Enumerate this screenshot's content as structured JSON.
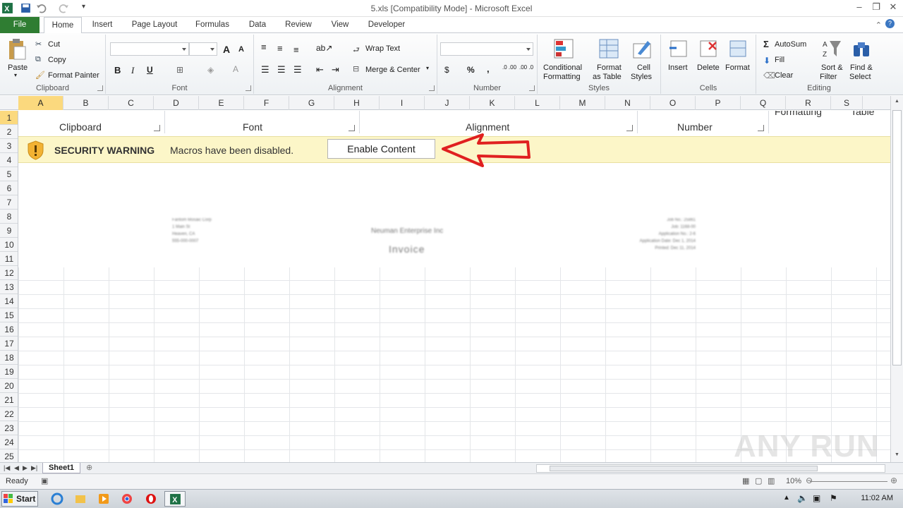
{
  "window": {
    "title": "5.xls  [Compatibility Mode]  -  Microsoft Excel"
  },
  "tabs": [
    "File",
    "Home",
    "Insert",
    "Page Layout",
    "Formulas",
    "Data",
    "Review",
    "View",
    "Developer"
  ],
  "ribbon": {
    "clipboard": {
      "paste": "Paste",
      "cut": "Cut",
      "copy": "Copy",
      "format_painter": "Format Painter",
      "label": "Clipboard"
    },
    "font": {
      "label": "Font",
      "bold": "B",
      "italic": "I",
      "underline": "U",
      "grow": "A",
      "shrink": "A"
    },
    "alignment": {
      "label": "Alignment",
      "wrap": "Wrap Text",
      "merge": "Merge & Center"
    },
    "number": {
      "label": "Number",
      "currency": "$",
      "percent": "%",
      "comma": ",",
      "inc": ".0 .00",
      "dec": ".00 .0"
    },
    "styles": {
      "label": "Styles",
      "conditional_1": "Conditional",
      "conditional_2": "Formatting",
      "format_table_1": "Format",
      "format_table_2": "as Table",
      "cell_styles_1": "Cell",
      "cell_styles_2": "Styles"
    },
    "cells": {
      "label": "Cells",
      "insert": "Insert",
      "delete": "Delete",
      "format": "Format"
    },
    "editing": {
      "label": "Editing",
      "autosum": "AutoSum",
      "fill": "Fill",
      "clear": "Clear",
      "sort_1": "Sort &",
      "sort_2": "Filter",
      "find_1": "Find &",
      "find_2": "Select"
    }
  },
  "columns": [
    "A",
    "B",
    "C",
    "D",
    "E",
    "F",
    "G",
    "H",
    "I",
    "J",
    "K",
    "L",
    "M",
    "N",
    "O",
    "P",
    "Q",
    "R",
    "S"
  ],
  "rows": [
    "1",
    "2",
    "3",
    "4",
    "5",
    "6",
    "7",
    "8",
    "9",
    "10",
    "11",
    "12",
    "13",
    "14",
    "15",
    "16",
    "17",
    "18",
    "19",
    "20",
    "21",
    "22",
    "23",
    "24",
    "25"
  ],
  "embedded": {
    "ghost_labels": [
      "Clipboard",
      "Font",
      "Alignment",
      "Number",
      "Formatting",
      "Table"
    ],
    "warning_title": "SECURITY WARNING",
    "warning_text": "Macros have been disabled.",
    "enable_button": "Enable Content",
    "doc_company": "Neuman Enterprise Inc",
    "doc_title": "Invoice",
    "doc_left": [
      "Fantom Mosaic Corp",
      "1 Main St",
      "Heaven, CA",
      "555-000-0007"
    ],
    "doc_right": [
      "Job No.: 25861",
      "Job: 1168-00",
      "Application No.: 2-6",
      "Application Date: Dec 1, 2014",
      "Printed: Dec 11, 2014"
    ]
  },
  "sheets": [
    "Sheet1"
  ],
  "status": {
    "ready": "Ready",
    "zoom": "10%"
  },
  "taskbar": {
    "start": "Start",
    "clock": "11:02 AM"
  },
  "watermark": "ANY RUN"
}
